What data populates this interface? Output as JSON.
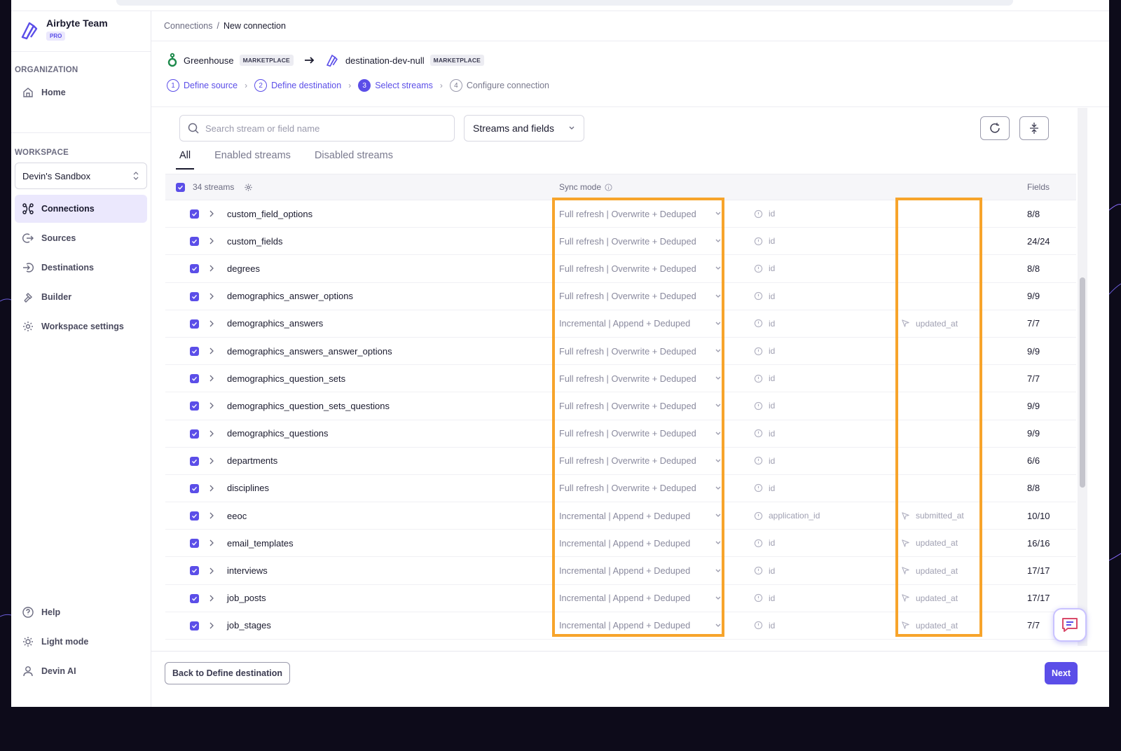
{
  "brand": {
    "name": "Airbyte Team",
    "plan": "PRO"
  },
  "sidebar": {
    "org_label": "ORGANIZATION",
    "home": "Home",
    "workspace_label": "WORKSPACE",
    "workspace": "Devin's Sandbox",
    "items": [
      "Connections",
      "Sources",
      "Destinations",
      "Builder",
      "Workspace settings"
    ],
    "help": "Help",
    "mode": "Light mode",
    "user": "Devin AI"
  },
  "breadcrumb": {
    "root": "Connections",
    "sep": "/",
    "current": "New connection"
  },
  "connection": {
    "source": "Greenhouse",
    "source_tag": "MARKETPLACE",
    "destination": "destination-dev-null",
    "destination_tag": "MARKETPLACE"
  },
  "steps": [
    {
      "num": "1",
      "label": "Define source"
    },
    {
      "num": "2",
      "label": "Define destination"
    },
    {
      "num": "3",
      "label": "Select streams"
    },
    {
      "num": "4",
      "label": "Configure connection"
    }
  ],
  "search": {
    "placeholder": "Search stream or field name"
  },
  "filter": {
    "value": "Streams and fields"
  },
  "tabs": [
    "All",
    "Enabled streams",
    "Disabled streams"
  ],
  "table": {
    "count": "34 streams",
    "sync_mode_header": "Sync mode",
    "fields_header": "Fields",
    "rows": [
      {
        "name": "custom_field_options",
        "sync": "Full refresh | Overwrite + Deduped",
        "pk": "id",
        "cursor": "",
        "fields": "8/8"
      },
      {
        "name": "custom_fields",
        "sync": "Full refresh | Overwrite + Deduped",
        "pk": "id",
        "cursor": "",
        "fields": "24/24"
      },
      {
        "name": "degrees",
        "sync": "Full refresh | Overwrite + Deduped",
        "pk": "id",
        "cursor": "",
        "fields": "8/8"
      },
      {
        "name": "demographics_answer_options",
        "sync": "Full refresh | Overwrite + Deduped",
        "pk": "id",
        "cursor": "",
        "fields": "9/9"
      },
      {
        "name": "demographics_answers",
        "sync": "Incremental | Append + Deduped",
        "pk": "id",
        "cursor": "updated_at",
        "fields": "7/7"
      },
      {
        "name": "demographics_answers_answer_options",
        "sync": "Full refresh | Overwrite + Deduped",
        "pk": "id",
        "cursor": "",
        "fields": "9/9"
      },
      {
        "name": "demographics_question_sets",
        "sync": "Full refresh | Overwrite + Deduped",
        "pk": "id",
        "cursor": "",
        "fields": "7/7"
      },
      {
        "name": "demographics_question_sets_questions",
        "sync": "Full refresh | Overwrite + Deduped",
        "pk": "id",
        "cursor": "",
        "fields": "9/9"
      },
      {
        "name": "demographics_questions",
        "sync": "Full refresh | Overwrite + Deduped",
        "pk": "id",
        "cursor": "",
        "fields": "9/9"
      },
      {
        "name": "departments",
        "sync": "Full refresh | Overwrite + Deduped",
        "pk": "id",
        "cursor": "",
        "fields": "6/6"
      },
      {
        "name": "disciplines",
        "sync": "Full refresh | Overwrite + Deduped",
        "pk": "id",
        "cursor": "",
        "fields": "8/8"
      },
      {
        "name": "eeoc",
        "sync": "Incremental | Append + Deduped",
        "pk": "application_id",
        "cursor": "submitted_at",
        "fields": "10/10"
      },
      {
        "name": "email_templates",
        "sync": "Incremental | Append + Deduped",
        "pk": "id",
        "cursor": "updated_at",
        "fields": "16/16"
      },
      {
        "name": "interviews",
        "sync": "Incremental | Append + Deduped",
        "pk": "id",
        "cursor": "updated_at",
        "fields": "17/17"
      },
      {
        "name": "job_posts",
        "sync": "Incremental | Append + Deduped",
        "pk": "id",
        "cursor": "updated_at",
        "fields": "17/17"
      },
      {
        "name": "job_stages",
        "sync": "Incremental | Append + Deduped",
        "pk": "id",
        "cursor": "updated_at",
        "fields": "7/7"
      }
    ]
  },
  "footer": {
    "back": "Back to Define destination",
    "next": "Next"
  },
  "colors": {
    "accent": "#5b4ee8",
    "highlight": "#f7a42b"
  }
}
